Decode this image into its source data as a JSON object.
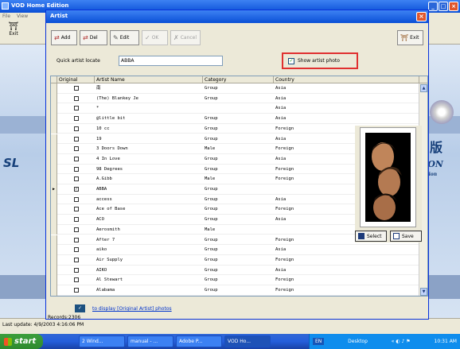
{
  "bg_app": {
    "title": "VOD Home Edition",
    "menu": [
      "File",
      "View"
    ],
    "exit_label": "Exit",
    "status": "Last update: 4/9/2003 4:16:06 PM",
    "banner_right": [
      "月版",
      "TION",
      "Version"
    ],
    "banner_left": "SL"
  },
  "dialog": {
    "title": "Artist",
    "toolbar": {
      "add": "Add",
      "del": "Del",
      "edit": "Edit",
      "ok": "OK",
      "cancel": "Cancel",
      "exit": "Exit"
    },
    "quick_locate_label": "Quick artist locate",
    "quick_locate_value": "ABBA",
    "show_photo_label": "Show artist photo",
    "columns": [
      "Original",
      "Artist Name",
      "Category",
      "Country"
    ],
    "rows": [
      {
        "original": false,
        "name": "南",
        "category": "Group",
        "country": "Asia"
      },
      {
        "original": false,
        "name": "(The) Blankey Je",
        "category": "Group",
        "country": "Asia"
      },
      {
        "original": false,
        "name": "*",
        "category": "",
        "country": "Asia"
      },
      {
        "original": false,
        "name": "@little bit",
        "category": "Group",
        "country": "Asia"
      },
      {
        "original": false,
        "name": "10 cc",
        "category": "Group",
        "country": "Foreign"
      },
      {
        "original": false,
        "name": "19",
        "category": "Group",
        "country": "Asia"
      },
      {
        "original": false,
        "name": "3 Doors Down",
        "category": "Male",
        "country": "Foreign"
      },
      {
        "original": false,
        "name": "4 In Love",
        "category": "Group",
        "country": "Asia"
      },
      {
        "original": false,
        "name": "98 Degrees",
        "category": "Group",
        "country": "Foreign"
      },
      {
        "original": false,
        "name": "A.Gibb",
        "category": "Male",
        "country": "Foreign"
      },
      {
        "original": true,
        "name": "ABBA",
        "category": "Group",
        "country": ""
      },
      {
        "original": false,
        "name": "access",
        "category": "Group",
        "country": "Asia"
      },
      {
        "original": false,
        "name": "Ace of Base",
        "category": "Group",
        "country": "Foreign"
      },
      {
        "original": false,
        "name": "ACO",
        "category": "Group",
        "country": "Asia"
      },
      {
        "original": false,
        "name": "Aerosmith",
        "category": "Male",
        "country": ""
      },
      {
        "original": false,
        "name": "After 7",
        "category": "Group",
        "country": "Foreign"
      },
      {
        "original": false,
        "name": "aiko",
        "category": "Group",
        "country": "Asia"
      },
      {
        "original": false,
        "name": "Air Supply",
        "category": "Group",
        "country": "Foreign"
      },
      {
        "original": false,
        "name": "AIKO",
        "category": "Group",
        "country": "Asia"
      },
      {
        "original": false,
        "name": "Al Stewart",
        "category": "Group",
        "country": "Foreign"
      },
      {
        "original": false,
        "name": "Alabama",
        "category": "Group",
        "country": "Foreign"
      }
    ],
    "select_label": "Select",
    "save_label": "Save",
    "bottom_link": "to display [Original Artist] photos",
    "records": "Records:2306"
  },
  "taskbar": {
    "start": "start",
    "items": [
      "2 Wind...",
      "manual - ...",
      "Adobe P...",
      "VOD Ho..."
    ],
    "lang": "EN",
    "desktop": "Desktop",
    "clock": "10:31 AM"
  },
  "colors": {
    "titlebar": "#0a4fd6",
    "highlight_border": "#e03030",
    "link": "#0033cc"
  }
}
